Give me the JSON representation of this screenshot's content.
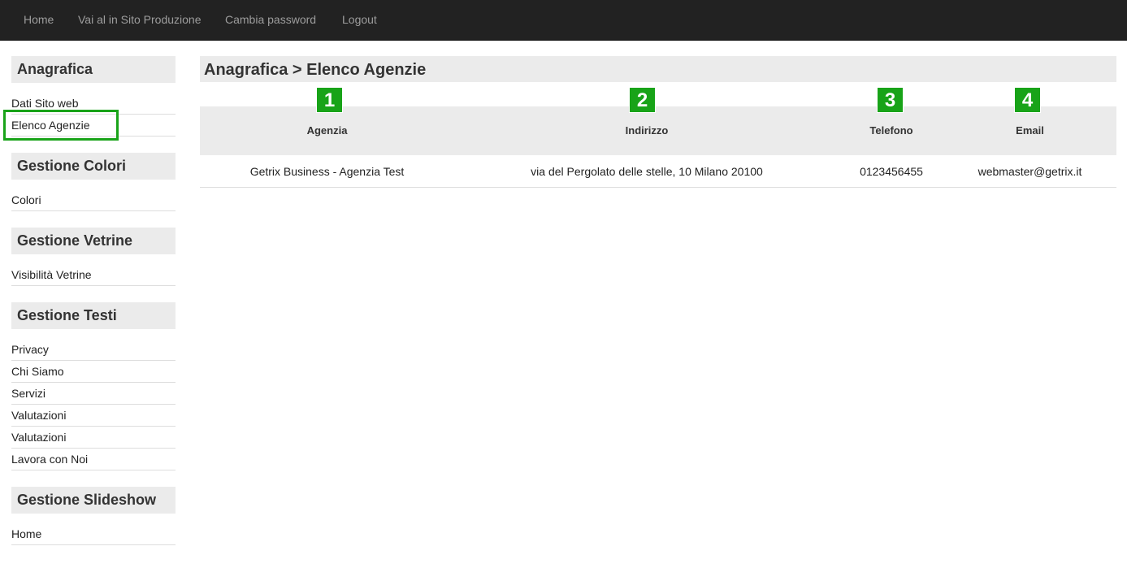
{
  "navbar": {
    "items": [
      "Home",
      "Vai al in Sito Produzione",
      "Cambia password",
      "Logout"
    ]
  },
  "sidebar": {
    "sections": [
      {
        "title": "Anagrafica",
        "items": [
          "Dati Sito web",
          "Elenco Agenzie"
        ]
      },
      {
        "title": "Gestione Colori",
        "items": [
          "Colori"
        ]
      },
      {
        "title": "Gestione Vetrine",
        "items": [
          "Visibilità Vetrine"
        ]
      },
      {
        "title": "Gestione Testi",
        "items": [
          "Privacy",
          "Chi Siamo",
          "Servizi",
          "Valutazioni",
          "Valutazioni",
          "Lavora con Noi"
        ]
      },
      {
        "title": "Gestione Slideshow",
        "items": [
          "Home"
        ]
      }
    ]
  },
  "main": {
    "title": "Anagrafica > Elenco Agenzie",
    "table": {
      "headers": [
        "Agenzia",
        "Indirizzo",
        "Telefono",
        "Email"
      ],
      "rows": [
        [
          "Getrix Business - Agenzia Test",
          "via del Pergolato delle stelle, 10 Milano 20100",
          "0123456455",
          "webmaster@getrix.it"
        ]
      ]
    },
    "badges": [
      "1",
      "2",
      "3",
      "4"
    ]
  },
  "colors": {
    "highlight": "#19a319",
    "navbar": "#222222",
    "section_header": "#ebebeb"
  }
}
